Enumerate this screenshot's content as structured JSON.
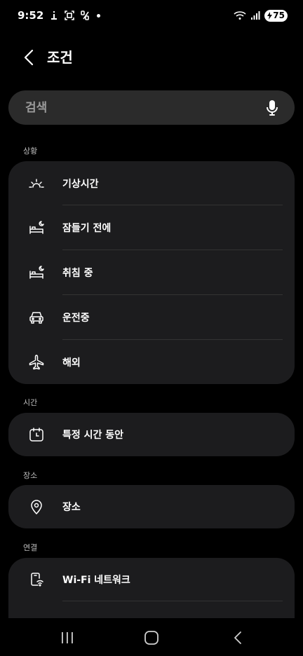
{
  "status_bar": {
    "time": "9:52",
    "battery": "75"
  },
  "header": {
    "title": "조건"
  },
  "search": {
    "placeholder": "검색"
  },
  "sections": {
    "situation": {
      "label": "상황",
      "items": [
        {
          "label": "기상시간",
          "icon": "sunrise-icon"
        },
        {
          "label": "잠들기 전에",
          "icon": "bed-moon-icon"
        },
        {
          "label": "취침 중",
          "icon": "bed-moon-icon"
        },
        {
          "label": "운전중",
          "icon": "car-icon"
        },
        {
          "label": "해외",
          "icon": "airplane-icon"
        }
      ]
    },
    "time": {
      "label": "시간",
      "items": [
        {
          "label": "특정 시간 동안",
          "icon": "calendar-clock-icon"
        }
      ]
    },
    "place": {
      "label": "장소",
      "items": [
        {
          "label": "장소",
          "icon": "location-pin-icon"
        }
      ]
    },
    "connection": {
      "label": "연결",
      "items": [
        {
          "label": "Wi-Fi 네트워크",
          "icon": "phone-wifi-icon"
        }
      ]
    }
  }
}
